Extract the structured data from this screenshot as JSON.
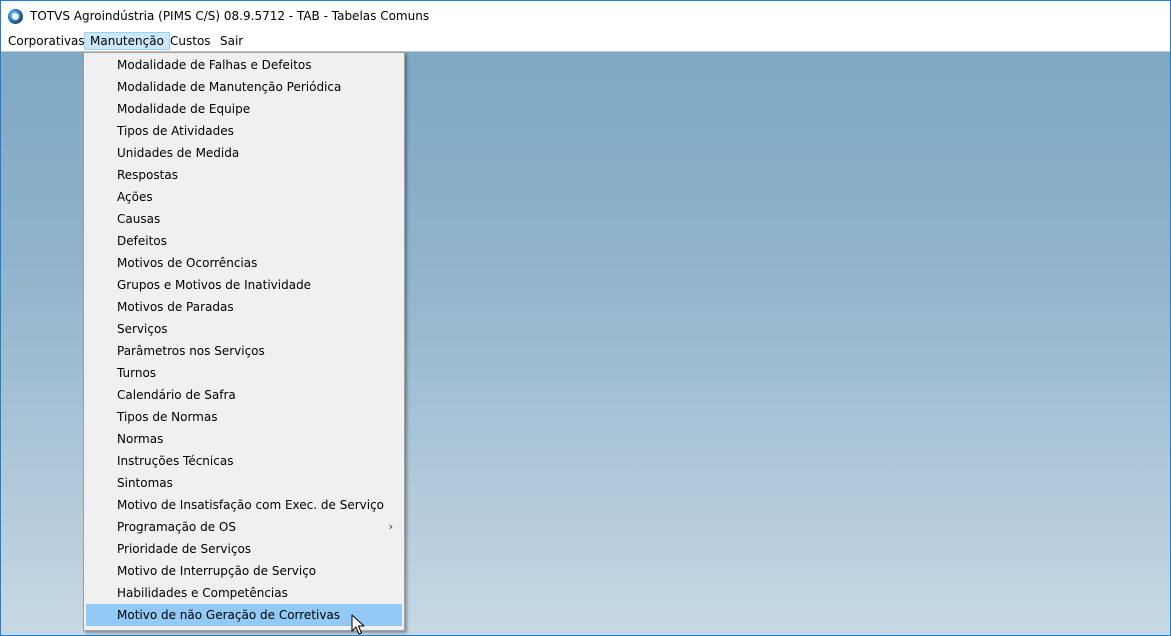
{
  "window": {
    "title": "TOTVS Agroindústria (PIMS C/S) 08.9.5712 - TAB - Tabelas Comuns"
  },
  "menubar": {
    "items": [
      {
        "label": "Corporativas"
      },
      {
        "label": "Manutenção"
      },
      {
        "label": "Custos"
      },
      {
        "label": "Sair"
      }
    ],
    "active": "Manutenção"
  },
  "dropdown": {
    "items": [
      {
        "label": "Modalidade de Falhas e Defeitos"
      },
      {
        "label": "Modalidade de Manutenção Periódica"
      },
      {
        "label": "Modalidade de Equipe"
      },
      {
        "label": "Tipos de Atividades"
      },
      {
        "label": "Unidades de Medida"
      },
      {
        "label": "Respostas"
      },
      {
        "label": "Ações"
      },
      {
        "label": "Causas"
      },
      {
        "label": "Defeitos"
      },
      {
        "label": "Motivos de Ocorrências"
      },
      {
        "label": "Grupos e Motivos de Inatividade"
      },
      {
        "label": "Motivos de Paradas"
      },
      {
        "label": "Serviços"
      },
      {
        "label": "Parâmetros nos Serviços"
      },
      {
        "label": "Turnos"
      },
      {
        "label": "Calendário de Safra"
      },
      {
        "label": "Tipos de Normas"
      },
      {
        "label": "Normas"
      },
      {
        "label": "Instruções Técnicas"
      },
      {
        "label": "Sintomas"
      },
      {
        "label": "Motivo de Insatisfação com Exec. de Serviço"
      },
      {
        "label": "Programação de OS",
        "submenu": true
      },
      {
        "label": "Prioridade de Serviços"
      },
      {
        "label": "Motivo de Interrupção de Serviço"
      },
      {
        "label": "Habilidades e Competências"
      },
      {
        "label": "Motivo de não Geração de Corretivas",
        "highlighted": true
      }
    ],
    "submenu_arrow": "›"
  },
  "colors": {
    "menu_highlight": "#91c9f7",
    "menubar_active": "#cce8ff",
    "desktop_top": "#7ea8c5",
    "desktop_bottom": "#c8d9e4"
  }
}
